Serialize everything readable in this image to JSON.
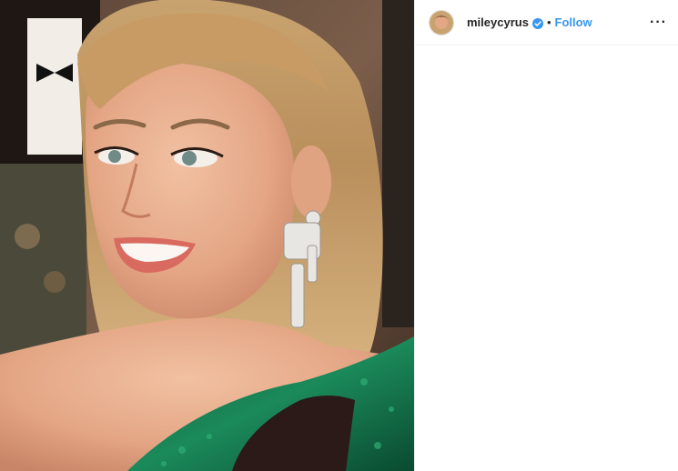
{
  "post": {
    "author": {
      "username": "mileycyrus",
      "verified": true,
      "separator": "•",
      "follow_label": "Follow",
      "more_label": "···"
    },
    "photo": {
      "alt_icon": "portrait-photo"
    }
  },
  "colors": {
    "follow_blue": "#3897f0",
    "verified_blue": "#3897f0",
    "text_dark": "#262626",
    "border": "#efefef"
  }
}
